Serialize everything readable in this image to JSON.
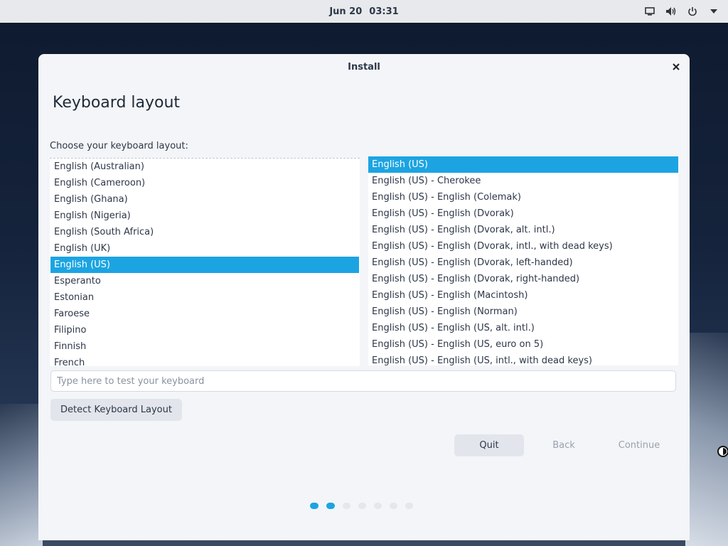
{
  "topbar": {
    "date": "Jun 20",
    "time": "03:31",
    "icons": [
      "display-icon",
      "volume-icon",
      "power-icon",
      "chevron-down-icon"
    ]
  },
  "window": {
    "title": "Install",
    "heading": "Keyboard layout",
    "prompt": "Choose your keyboard layout:"
  },
  "layouts": [
    {
      "label": "English (Australian)",
      "selected": false
    },
    {
      "label": "English (Cameroon)",
      "selected": false
    },
    {
      "label": "English (Ghana)",
      "selected": false
    },
    {
      "label": "English (Nigeria)",
      "selected": false
    },
    {
      "label": "English (South Africa)",
      "selected": false
    },
    {
      "label": "English (UK)",
      "selected": false
    },
    {
      "label": "English (US)",
      "selected": true
    },
    {
      "label": "Esperanto",
      "selected": false
    },
    {
      "label": "Estonian",
      "selected": false
    },
    {
      "label": "Faroese",
      "selected": false
    },
    {
      "label": "Filipino",
      "selected": false
    },
    {
      "label": "Finnish",
      "selected": false
    },
    {
      "label": "French",
      "selected": false
    }
  ],
  "variants": [
    {
      "label": "English (US)",
      "selected": true
    },
    {
      "label": "English (US) - Cherokee",
      "selected": false
    },
    {
      "label": "English (US) - English (Colemak)",
      "selected": false
    },
    {
      "label": "English (US) - English (Dvorak)",
      "selected": false
    },
    {
      "label": "English (US) - English (Dvorak, alt. intl.)",
      "selected": false
    },
    {
      "label": "English (US) - English (Dvorak, intl., with dead keys)",
      "selected": false
    },
    {
      "label": "English (US) - English (Dvorak, left-handed)",
      "selected": false
    },
    {
      "label": "English (US) - English (Dvorak, right-handed)",
      "selected": false
    },
    {
      "label": "English (US) - English (Macintosh)",
      "selected": false
    },
    {
      "label": "English (US) - English (Norman)",
      "selected": false
    },
    {
      "label": "English (US) - English (US, alt. intl.)",
      "selected": false
    },
    {
      "label": "English (US) - English (US, euro on 5)",
      "selected": false
    },
    {
      "label": "English (US) - English (US, intl., with dead keys)",
      "selected": false
    }
  ],
  "test_input": {
    "placeholder": "Type here to test your keyboard",
    "value": ""
  },
  "buttons": {
    "detect": "Detect Keyboard Layout",
    "quit": "Quit",
    "back": "Back",
    "continue": "Continue"
  },
  "progress": {
    "total_steps": 7,
    "completed_steps": 2
  },
  "colors": {
    "accent": "#1ca4e2",
    "window_bg": "#f3f5f8",
    "topbar_bg": "#e7e9ec"
  }
}
